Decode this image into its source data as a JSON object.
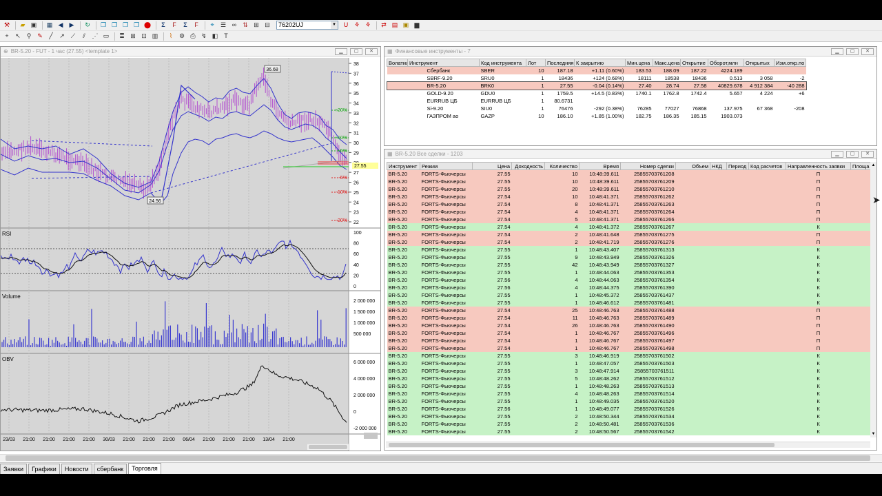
{
  "toolbar": {
    "account_value": "76202UJ",
    "icons_row1": [
      "tool-icon",
      "open-icon",
      "save-icon",
      "table-icon",
      "back-icon",
      "forward-icon",
      "refresh-icon",
      "copy-icon",
      "paste-icon",
      "stop-icon",
      "sum-icon",
      "sum-filter-icon",
      "sum-percent-icon",
      "filter-icon",
      "order-icon",
      "orders-icon",
      "binoculars-icon",
      "trade-icon",
      "list-icon",
      "ticker-icon",
      "chart-icon",
      "book-icon"
    ],
    "icons_row2": [
      "pointer-icon",
      "cursor-icon",
      "zoom-icon",
      "pencil-icon",
      "line-icon",
      "arrow-icon",
      "ray-icon",
      "channel-icon",
      "fib-icon",
      "rect-icon",
      "text-icon",
      "grid-icon",
      "bars-icon",
      "levels-icon",
      "label-icon",
      "wave-icon",
      "settings-icon",
      "print-icon",
      "indicator-icon",
      "palette-icon"
    ]
  },
  "chart_window": {
    "title": "BR-5.20 - FUT - 1 час (27.55) <template 1>",
    "price_label": "27.55",
    "high_label": "36.68",
    "low_label": "24.56",
    "rsi_label": "RSI",
    "volume_label": "Volume",
    "obv_label": "OBV",
    "price_ticks": [
      "38",
      "37",
      "36",
      "35",
      "34",
      "33",
      "32",
      "31",
      "30",
      "29",
      "28",
      "27",
      "26",
      "25",
      "24",
      "23",
      "22"
    ],
    "percent_labels": [
      "+20%",
      "+10%",
      "+5%",
      "-5%",
      "-10%",
      "-20%"
    ],
    "rsi_ticks": [
      "100",
      "80",
      "60",
      "40",
      "20",
      "0"
    ],
    "volume_ticks": [
      "2 000 000",
      "1 500 000",
      "1 000 000",
      "500 000"
    ],
    "obv_ticks": [
      "6 000 000",
      "4 000 000",
      "2 000 000",
      "0",
      "-2 000 000"
    ],
    "time_ticks": [
      "23/03",
      "21:00",
      "21:00",
      "21:00",
      "21:00",
      "30/03",
      "21:00",
      "21:00",
      "21:00",
      "06/04",
      "21:00",
      "21:00",
      "21:00",
      "13/04",
      "21:00"
    ]
  },
  "fi_window": {
    "title": "Финансовые инструменты - 7",
    "columns": [
      "Волатил",
      "Инструмент",
      "Код инструмента",
      "Лот",
      "Последняя",
      "К закрытию",
      "Мин.цена",
      "Макс.цена",
      "Открытие",
      "Оборот,млн",
      "Открытых",
      "Изм.откр.по"
    ],
    "rows": [
      {
        "c": [
          "",
          "Сбербанк",
          "SBER",
          "10",
          "187.18",
          "+1.11 (0.60%)",
          "183.53",
          "188.09",
          "187.22",
          "4224.189",
          "",
          ""
        ],
        "bg": "#f7c9bf"
      },
      {
        "c": [
          "",
          "SBRF-9.20",
          "SRU0",
          "1",
          "18436",
          "+124 (0.68%)",
          "18111",
          "18538",
          "18436",
          "0.513",
          "3 058",
          "-2"
        ],
        "bg": "#ffffff"
      },
      {
        "c": [
          "",
          "BR-5.20",
          "BRK0",
          "1",
          "27.55",
          "-0.04 (0.14%)",
          "27.40",
          "28.74",
          "27.58",
          "40829.678",
          "4 912 384",
          "-40 288"
        ],
        "bg": "#f7c9bf"
      },
      {
        "c": [
          "",
          "GOLD-9.20",
          "GDU0",
          "1",
          "1759.5",
          "+14.5 (0.83%)",
          "1740.1",
          "1762.8",
          "1742.4",
          "5.657",
          "4 224",
          "+6"
        ],
        "bg": "#ffffff"
      },
      {
        "c": [
          "",
          "EURRUB ЦБ",
          "EURRUB ЦБ",
          "1",
          "80.6731",
          "",
          "",
          "",
          "",
          "",
          "",
          ""
        ],
        "bg": "#ffffff"
      },
      {
        "c": [
          "",
          "Si-9.20",
          "SIU0",
          "1",
          "76476",
          "-292 (0.38%)",
          "76285",
          "77027",
          "76868",
          "137.975",
          "67 368",
          "-208"
        ],
        "bg": "#ffffff"
      },
      {
        "c": [
          "",
          "ГАЗПРОМ ао",
          "GAZP",
          "10",
          "186.10",
          "+1.85 (1.00%)",
          "182.75",
          "186.35",
          "185.15",
          "1903.073",
          "",
          ""
        ],
        "bg": "#ffffff"
      }
    ]
  },
  "trades_window": {
    "title": "BR-5.20 Все сделки - 1203",
    "columns": [
      "Инструмент",
      "Режим",
      "Цена",
      "Доходность",
      "Количество",
      "Время",
      "Номер сделки",
      "Объем",
      "НКД",
      "Период",
      "Код расчетов",
      "Направленность заявки",
      "Площа"
    ],
    "instrument": "BR-5.20",
    "mode": "FORTS-Фьючерсы",
    "rows": [
      [
        "27.55",
        "10",
        "10:48:39.611",
        "25855703761208",
        "П"
      ],
      [
        "27.55",
        "10",
        "10:48:39.611",
        "25855703761209",
        "П"
      ],
      [
        "27.55",
        "20",
        "10:48:39.611",
        "25855703761210",
        "П"
      ],
      [
        "27.54",
        "10",
        "10:48:41.371",
        "25855703761262",
        "П"
      ],
      [
        "27.54",
        "8",
        "10:48:41.371",
        "25855703761263",
        "П"
      ],
      [
        "27.54",
        "4",
        "10:48:41.371",
        "25855703761264",
        "П"
      ],
      [
        "27.54",
        "5",
        "10:48:41.371",
        "25855703761266",
        "П"
      ],
      [
        "27.54",
        "4",
        "10:48:41.372",
        "25855703761267",
        "К"
      ],
      [
        "27.54",
        "2",
        "10:48:41.648",
        "25855703761275",
        "П"
      ],
      [
        "27.54",
        "2",
        "10:48:41.719",
        "25855703761276",
        "П"
      ],
      [
        "27.55",
        "1",
        "10:48:43.407",
        "25855703761313",
        "К"
      ],
      [
        "27.55",
        "9",
        "10:48:43.949",
        "25855703761326",
        "К"
      ],
      [
        "27.55",
        "42",
        "10:48:43.949",
        "25855703761327",
        "К"
      ],
      [
        "27.55",
        "1",
        "10:48:44.063",
        "25855703761353",
        "К"
      ],
      [
        "27.56",
        "4",
        "10:48:44.063",
        "25855703761354",
        "К"
      ],
      [
        "27.56",
        "4",
        "10:48:44.375",
        "25855703761390",
        "К"
      ],
      [
        "27.55",
        "1",
        "10:48:45.372",
        "25855703761437",
        "К"
      ],
      [
        "27.55",
        "1",
        "10:48:46.612",
        "25855703761481",
        "К"
      ],
      [
        "27.54",
        "25",
        "10:48:46.763",
        "25855703761488",
        "П"
      ],
      [
        "27.54",
        "11",
        "10:48:46.763",
        "25855703761489",
        "П"
      ],
      [
        "27.54",
        "26",
        "10:48:46.763",
        "25855703761490",
        "П"
      ],
      [
        "27.54",
        "1",
        "10:48:46.767",
        "25855703761496",
        "П"
      ],
      [
        "27.54",
        "1",
        "10:48:46.767",
        "25855703761497",
        "П"
      ],
      [
        "27.54",
        "1",
        "10:48:46.767",
        "25855703761498",
        "П"
      ],
      [
        "27.55",
        "3",
        "10:48:46.919",
        "25855703761502",
        "К"
      ],
      [
        "27.55",
        "1",
        "10:48:47.057",
        "25855703761503",
        "К"
      ],
      [
        "27.55",
        "3",
        "10:48:47.914",
        "25855703761511",
        "К"
      ],
      [
        "27.55",
        "5",
        "10:48:48.262",
        "25855703761512",
        "К"
      ],
      [
        "27.55",
        "1",
        "10:48:48.263",
        "25855703761513",
        "К"
      ],
      [
        "27.55",
        "4",
        "10:48:48.263",
        "25855703761514",
        "К"
      ],
      [
        "27.55",
        "1",
        "10:48:49.035",
        "25855703761520",
        "К"
      ],
      [
        "27.56",
        "1",
        "10:48:49.077",
        "25855703761526",
        "К"
      ],
      [
        "27.55",
        "2",
        "10:48:50.344",
        "25855703761534",
        "К"
      ],
      [
        "27.55",
        "2",
        "10:48:50.481",
        "25855703761536",
        "К"
      ],
      [
        "27.55",
        "2",
        "10:48:50.567",
        "25855703761542",
        "К"
      ]
    ]
  },
  "tabs": [
    "Заявки",
    "Графики",
    "Новости",
    "сбербанк",
    "Торговля"
  ],
  "active_tab": "Торговля",
  "colors": {
    "sell_row": "#f7c9bf",
    "buy_row": "#c6f2c6",
    "selected_row": "#f2c3b8",
    "ma_line": "#3333cc",
    "candle": "#b34fcf"
  }
}
